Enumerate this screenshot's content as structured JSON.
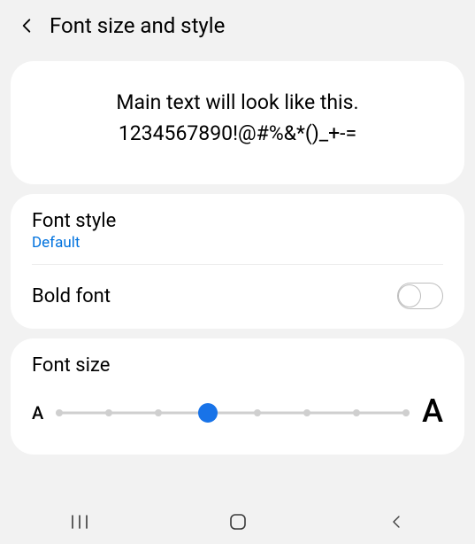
{
  "header": {
    "title": "Font size and style"
  },
  "preview": {
    "line1": "Main text will look like this.",
    "line2": "1234567890!@#%&*()_+-="
  },
  "fontStyle": {
    "title": "Font style",
    "value": "Default"
  },
  "bold": {
    "title": "Bold font",
    "on": false
  },
  "size": {
    "title": "Font size",
    "ticks": 8,
    "selectedIndex": 3,
    "indicator_small": "A",
    "indicator_large": "A"
  }
}
